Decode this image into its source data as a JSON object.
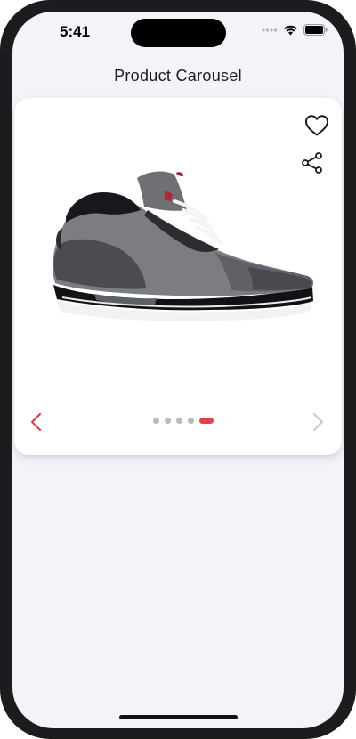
{
  "status_bar": {
    "time": "5:41"
  },
  "nav": {
    "title": "Product Carousel"
  },
  "carousel": {
    "total_slides": 5,
    "active_index": 4,
    "current_product": "basketball-sneaker-grey-black",
    "actions": {
      "favorite_icon": "heart-outline-icon",
      "share_icon": "share-icon"
    },
    "nav_icons": {
      "prev": "chevron-left-icon",
      "next": "chevron-right-icon"
    },
    "prev_enabled": true,
    "next_enabled": false
  },
  "colors": {
    "accent": "#e8404d",
    "inactive_dot": "#b9b9be",
    "background": "#f5f3f9",
    "card": "#ffffff",
    "disabled": "#c7c7cc"
  }
}
